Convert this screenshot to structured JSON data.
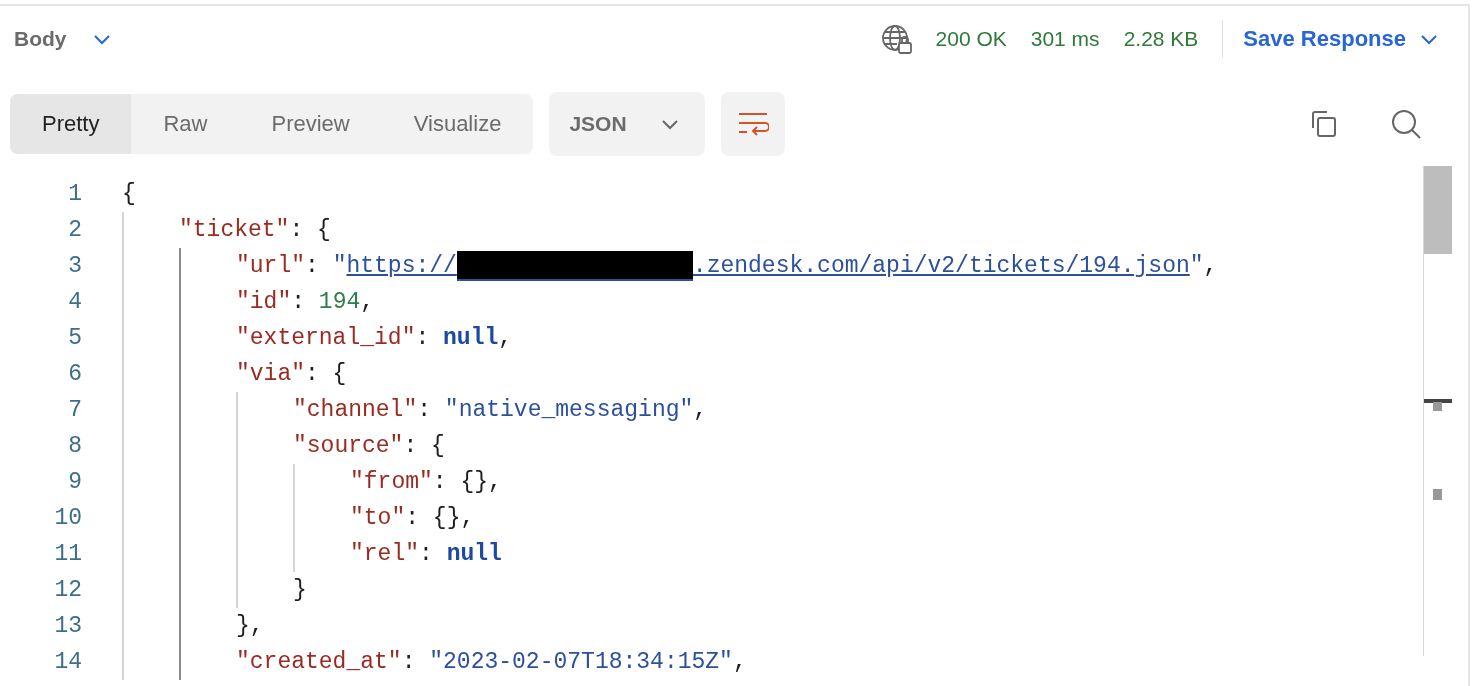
{
  "header": {
    "title": "Body",
    "status": "200 OK",
    "time": "301 ms",
    "size": "2.28 KB",
    "save_button": "Save Response"
  },
  "view_tabs": [
    {
      "label": "Pretty",
      "selected": true
    },
    {
      "label": "Raw",
      "selected": false
    },
    {
      "label": "Preview",
      "selected": false
    },
    {
      "label": "Visualize",
      "selected": false
    }
  ],
  "format_dropdown": {
    "value": "JSON"
  },
  "code_lines": [
    {
      "number": "1",
      "tokens": [
        {
          "kind": "punct",
          "text": "{"
        }
      ],
      "children": [
        {
          "number": "2",
          "tokens": [
            {
              "kind": "key",
              "text": "\"ticket\""
            },
            {
              "kind": "punct",
              "text": ": {"
            }
          ],
          "children": [
            {
              "number": "3",
              "tokens": [
                {
                  "kind": "key",
                  "text": "\"url\""
                },
                {
                  "kind": "punct",
                  "text": ": "
                },
                {
                  "kind": "string",
                  "text": "\""
                },
                {
                  "kind": "link",
                  "text": "https://"
                },
                {
                  "kind": "redacted"
                },
                {
                  "kind": "link",
                  "text": ".zendesk.com/api/v2/tickets/194.json"
                },
                {
                  "kind": "string",
                  "text": "\""
                },
                {
                  "kind": "punct",
                  "text": ","
                }
              ]
            },
            {
              "number": "4",
              "tokens": [
                {
                  "kind": "key",
                  "text": "\"id\""
                },
                {
                  "kind": "punct",
                  "text": ": "
                },
                {
                  "kind": "number",
                  "text": "194"
                },
                {
                  "kind": "punct",
                  "text": ","
                }
              ]
            },
            {
              "number": "5",
              "tokens": [
                {
                  "kind": "key",
                  "text": "\"external_id\""
                },
                {
                  "kind": "punct",
                  "text": ": "
                },
                {
                  "kind": "null",
                  "text": "null"
                },
                {
                  "kind": "punct",
                  "text": ","
                }
              ]
            },
            {
              "number": "6",
              "tokens": [
                {
                  "kind": "key",
                  "text": "\"via\""
                },
                {
                  "kind": "punct",
                  "text": ": {"
                }
              ],
              "children": [
                {
                  "number": "7",
                  "tokens": [
                    {
                      "kind": "key",
                      "text": "\"channel\""
                    },
                    {
                      "kind": "punct",
                      "text": ": "
                    },
                    {
                      "kind": "string",
                      "text": "\"native_messaging\""
                    },
                    {
                      "kind": "punct",
                      "text": ","
                    }
                  ]
                },
                {
                  "number": "8",
                  "tokens": [
                    {
                      "kind": "key",
                      "text": "\"source\""
                    },
                    {
                      "kind": "punct",
                      "text": ": {"
                    }
                  ],
                  "children": [
                    {
                      "number": "9",
                      "tokens": [
                        {
                          "kind": "key",
                          "text": "\"from\""
                        },
                        {
                          "kind": "punct",
                          "text": ": {},"
                        }
                      ]
                    },
                    {
                      "number": "10",
                      "tokens": [
                        {
                          "kind": "key",
                          "text": "\"to\""
                        },
                        {
                          "kind": "punct",
                          "text": ": {},"
                        }
                      ]
                    },
                    {
                      "number": "11",
                      "tokens": [
                        {
                          "kind": "key",
                          "text": "\"rel\""
                        },
                        {
                          "kind": "punct",
                          "text": ": "
                        },
                        {
                          "kind": "null",
                          "text": "null"
                        }
                      ]
                    }
                  ]
                },
                {
                  "number": "12",
                  "tokens": [
                    {
                      "kind": "punct",
                      "text": "}"
                    }
                  ]
                }
              ]
            },
            {
              "number": "13",
              "tokens": [
                {
                  "kind": "punct",
                  "text": "},"
                }
              ]
            },
            {
              "number": "14",
              "tokens": [
                {
                  "kind": "key",
                  "text": "\"created_at\""
                },
                {
                  "kind": "punct",
                  "text": ": "
                },
                {
                  "kind": "string",
                  "text": "\"2023-02-07T18:34:15Z\""
                },
                {
                  "kind": "punct",
                  "text": ","
                }
              ]
            }
          ]
        }
      ]
    }
  ]
}
